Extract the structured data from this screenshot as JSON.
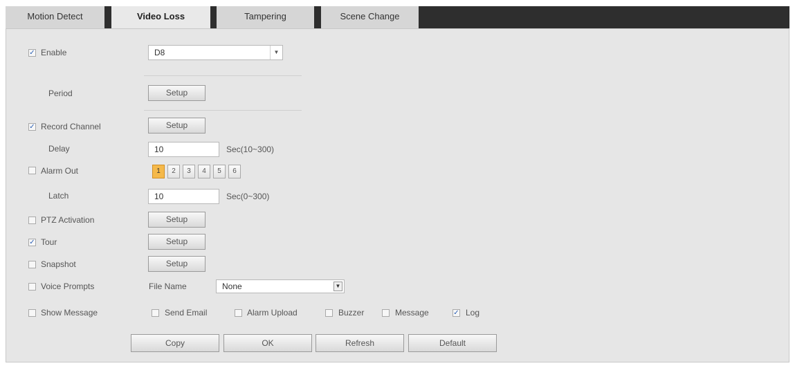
{
  "tabs": [
    {
      "label": "Motion Detect",
      "active": false
    },
    {
      "label": "Video Loss",
      "active": true
    },
    {
      "label": "Tampering",
      "active": false
    },
    {
      "label": "Scene Change",
      "active": false
    }
  ],
  "enable": {
    "label": "Enable",
    "checked": true,
    "channel_value": "D8"
  },
  "period": {
    "label": "Period",
    "button": "Setup"
  },
  "record_channel": {
    "label": "Record Channel",
    "checked": true,
    "button": "Setup"
  },
  "delay": {
    "label": "Delay",
    "value": "10",
    "unit": "Sec(10~300)"
  },
  "alarm_out": {
    "label": "Alarm Out",
    "checked": false,
    "channels": [
      "1",
      "2",
      "3",
      "4",
      "5",
      "6"
    ],
    "selected": "1"
  },
  "latch": {
    "label": "Latch",
    "value": "10",
    "unit": "Sec(0~300)"
  },
  "ptz_activation": {
    "label": "PTZ Activation",
    "checked": false,
    "button": "Setup"
  },
  "tour": {
    "label": "Tour",
    "checked": true,
    "button": "Setup"
  },
  "snapshot": {
    "label": "Snapshot",
    "checked": false,
    "button": "Setup"
  },
  "voice_prompts": {
    "label": "Voice Prompts",
    "checked": false,
    "file_name_label": "File Name",
    "file_value": "None"
  },
  "show_message": {
    "label": "Show Message",
    "checked": false
  },
  "options": {
    "send_email": {
      "label": "Send Email",
      "checked": false
    },
    "alarm_upload": {
      "label": "Alarm Upload",
      "checked": false
    },
    "buzzer": {
      "label": "Buzzer",
      "checked": false
    },
    "message": {
      "label": "Message",
      "checked": false
    },
    "log": {
      "label": "Log",
      "checked": true
    }
  },
  "buttons": {
    "copy": "Copy",
    "ok": "OK",
    "refresh": "Refresh",
    "default": "Default"
  },
  "check_mark": "✓",
  "colors": {
    "tab_bar": "#2e2e2e",
    "panel": "#e6e6e6",
    "selected_alarm": "#f5b94a",
    "check": "#2a5fb3"
  }
}
